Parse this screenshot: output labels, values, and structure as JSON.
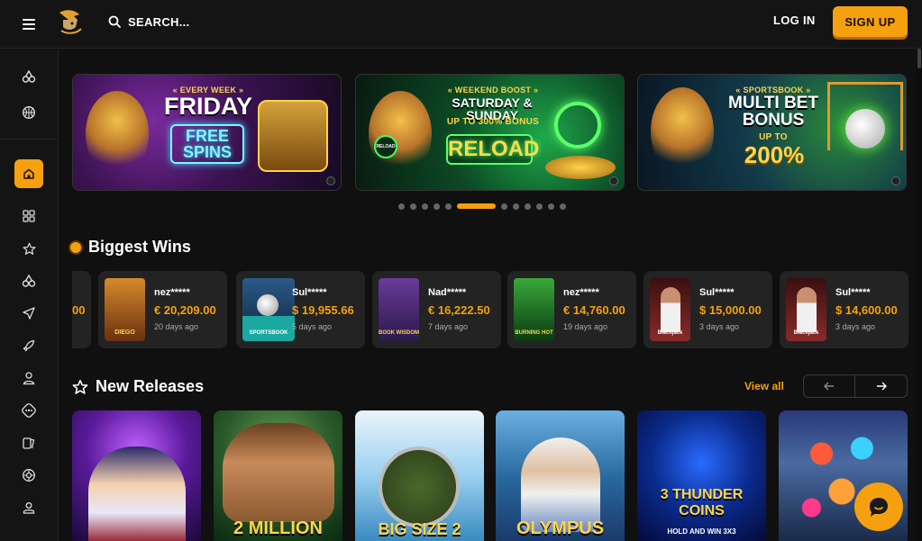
{
  "header": {
    "search_label": "SEARCH...",
    "login_label": "LOG IN",
    "signup_label": "SIGN UP",
    "accent_color": "#f5a00f"
  },
  "sidebar": {
    "items": [
      {
        "icon": "cherries-icon"
      },
      {
        "icon": "basketball-icon"
      },
      {
        "icon": "home-icon",
        "active": true
      },
      {
        "icon": "grid-icon"
      },
      {
        "icon": "star-icon"
      },
      {
        "icon": "cherries-icon"
      },
      {
        "icon": "plane-icon"
      },
      {
        "icon": "rocket-icon"
      },
      {
        "icon": "dealer-icon"
      },
      {
        "icon": "dice-icon"
      },
      {
        "icon": "cards-icon"
      },
      {
        "icon": "roulette-icon"
      },
      {
        "icon": "user-icon"
      }
    ]
  },
  "banners": [
    {
      "small": "« EVERY WEEK »",
      "big": "FRIDAY",
      "neon": "FREE SPINS"
    },
    {
      "small": "« WEEKEND BOOST »",
      "big": "SATURDAY & SUNDAY",
      "mid": "UP TO 300% BONUS",
      "neon": "RELOAD",
      "badge": "RELOAD"
    },
    {
      "small": "« SPORTSBOOK »",
      "big": "MULTI BET BONUS",
      "mid": "UP TO",
      "neon": "200%"
    }
  ],
  "carousel": {
    "dot_count": 12,
    "active_index": 5
  },
  "biggest_wins": {
    "title": "Biggest Wins",
    "partial_amount": "00",
    "items": [
      {
        "user": "nez*****",
        "amount": "€ 20,209.00",
        "time": "20 days ago",
        "game": "DIEGO"
      },
      {
        "user": "Sul*****",
        "amount": "$ 19,955.66",
        "time": "5 days ago",
        "game": "SPORTSBOOK"
      },
      {
        "user": "Nad*****",
        "amount": "€ 16,222.50",
        "time": "7 days ago",
        "game": "BOOK WISDOM"
      },
      {
        "user": "nez*****",
        "amount": "€ 14,760.00",
        "time": "19 days ago",
        "game": "BURNING HOT"
      },
      {
        "user": "Sul*****",
        "amount": "$ 15,000.00",
        "time": "3 days ago",
        "game": "Blackjack"
      },
      {
        "user": "Sul*****",
        "amount": "$ 14,600.00",
        "time": "3 days ago",
        "game": "Blackjack"
      }
    ]
  },
  "new_releases": {
    "title": "New Releases",
    "view_all": "View all",
    "games": [
      {
        "title": ""
      },
      {
        "title": "2 MILLION"
      },
      {
        "title": "BIG SIZE 2"
      },
      {
        "title": "OLYMPUS"
      },
      {
        "title": "3 THUNDER COINS",
        "sub": "HOLD AND WIN 3X3"
      },
      {
        "title": ""
      }
    ]
  }
}
